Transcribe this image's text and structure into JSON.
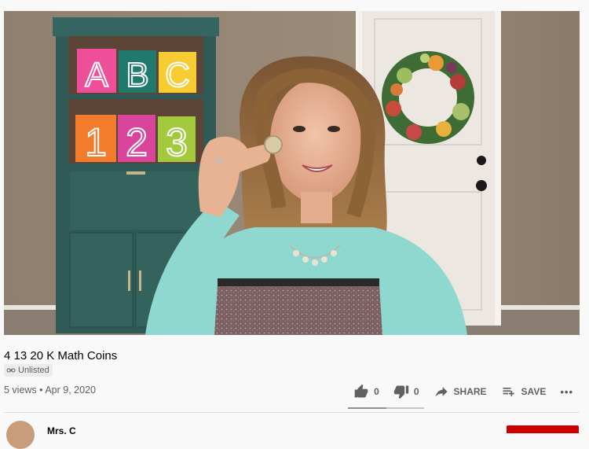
{
  "video": {
    "title": "4 13 20 K Math Coins",
    "visibility": "Unlisted",
    "views": "5 views",
    "date": "Apr 9, 2020"
  },
  "actions": {
    "likes": "0",
    "dislikes": "0",
    "share": "SHARE",
    "save": "SAVE",
    "more": "•••"
  },
  "like_ratio": 0.5,
  "blocks": {
    "top_letters": [
      "A",
      "B",
      "C"
    ],
    "bottom_numbers": [
      "1",
      "2",
      "3"
    ]
  },
  "channel": {
    "name": "Mrs. C"
  },
  "colors": {
    "subscribe": "#cc0000",
    "meta": "#606060"
  }
}
